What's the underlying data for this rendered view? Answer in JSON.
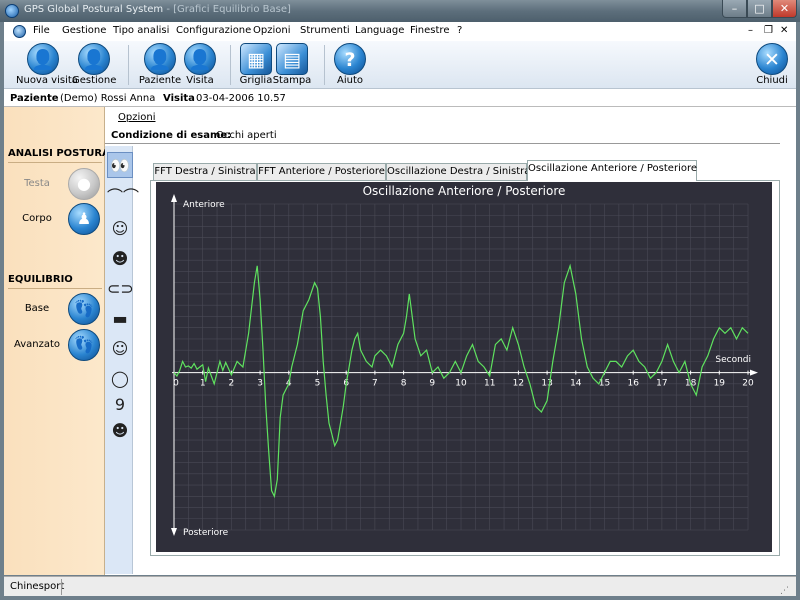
{
  "window": {
    "title": "GPS Global Postural System",
    "subtitle": " - [Grafici Equilibrio Base]"
  },
  "menubar": {
    "items": [
      "File",
      "Gestione",
      "Tipo analisi",
      "Configurazione",
      "Opzioni",
      "Strumenti",
      "Language",
      "Finestre",
      "?"
    ]
  },
  "toolbar": {
    "buttons": [
      "Nuova visita",
      "Gestione",
      "Paziente",
      "Visita",
      "Griglia",
      "Stampa",
      "Aiuto"
    ],
    "close_label": "Chiudi"
  },
  "patient": {
    "label_paziente": "Paziente",
    "name": "(Demo) Rossi Anna",
    "label_visita": "Visita",
    "visit_date": "03-04-2006 10.57"
  },
  "left_panel": {
    "analisi_header": "ANALISI POSTURALE",
    "testa": "Testa",
    "corpo": "Corpo",
    "equilibrio_header": "EQUILIBRIO",
    "base": "Base",
    "avanzato": "Avanzato"
  },
  "options_menu": "Opzioni",
  "condition": {
    "label": "Condizione di esame:",
    "value": "Occhi aperti"
  },
  "tabs": [
    "FFT Destra / Sinistra",
    "FFT Anteriore / Posteriore",
    "Oscillazione Destra / Sinistra",
    "Oscillazione Anteriore / Posteriore"
  ],
  "active_tab": 3,
  "icon_strip": [
    "eyes-open-icon",
    "eyes-closed-icon",
    "head-side-icon",
    "head-front-icon",
    "lips-icon",
    "lips-closed-icon",
    "head-profile-icon",
    "mouth-open-icon",
    "number-nine-icon",
    "head-tilt-icon"
  ],
  "status": {
    "text": "Chinesport"
  },
  "chart_data": {
    "type": "line",
    "title": "Oscillazione Anteriore / Posteriore",
    "xlabel": "Secondi",
    "y_top_label": "Anteriore",
    "y_bottom_label": "Posteriore",
    "xlim": [
      0,
      20
    ],
    "ylim": [
      -14,
      15
    ],
    "x_ticks": [
      "0",
      "1",
      "2",
      "3",
      "4",
      "5",
      "6",
      "7",
      "8",
      "9",
      "10",
      "11",
      "12",
      "13",
      "14",
      "15",
      "16",
      "17",
      "18",
      "19",
      "20"
    ],
    "grid": true,
    "colors": {
      "background": "#2f2f3a",
      "grid": "#4a4a56",
      "line": "#5fe25f",
      "axis": "#ffffff"
    },
    "series": [
      {
        "x": [
          0,
          0.1,
          0.2,
          0.3,
          0.4,
          0.5,
          0.6,
          0.7,
          0.8,
          0.9,
          1.0,
          1.1,
          1.2,
          1.4,
          1.6,
          1.7,
          1.8,
          2.0,
          2.2,
          2.4,
          2.6,
          2.8,
          2.9,
          3.0,
          3.1,
          3.2,
          3.3,
          3.4,
          3.5,
          3.6,
          3.7,
          3.8,
          3.9,
          4.0,
          4.1,
          4.3,
          4.5,
          4.7,
          4.9,
          5.0,
          5.1,
          5.2,
          5.3,
          5.4,
          5.5,
          5.6,
          5.7,
          5.8,
          5.9,
          6.0,
          6.1,
          6.2,
          6.3,
          6.4,
          6.5,
          6.7,
          6.9,
          7.0,
          7.2,
          7.4,
          7.6,
          7.8,
          8.0,
          8.1,
          8.2,
          8.4,
          8.6,
          8.8,
          9.0,
          9.2,
          9.4,
          9.6,
          9.8,
          10.0,
          10.2,
          10.4,
          10.6,
          10.8,
          11.0,
          11.2,
          11.4,
          11.6,
          11.8,
          12.0,
          12.2,
          12.4,
          12.6,
          12.8,
          13.0,
          13.2,
          13.4,
          13.6,
          13.8,
          14.0,
          14.2,
          14.4,
          14.6,
          14.8,
          15.0,
          15.2,
          15.4,
          15.6,
          15.8,
          16.0,
          16.2,
          16.4,
          16.6,
          16.8,
          17.0,
          17.2,
          17.4,
          17.6,
          17.8,
          18.0,
          18.2,
          18.4,
          18.6,
          18.8,
          19.0,
          19.2,
          19.4,
          19.6,
          19.8,
          20.0
        ],
        "y": [
          0,
          -0.3,
          0.2,
          1.0,
          0.5,
          0.6,
          0.4,
          0.8,
          0.3,
          0.5,
          0.7,
          -0.8,
          0.4,
          -1.0,
          1.0,
          0.2,
          0.9,
          -0.2,
          1.0,
          0.5,
          3.5,
          8.0,
          9.5,
          6.5,
          2.0,
          -3.0,
          -7.0,
          -10.5,
          -11.0,
          -9.5,
          -4.0,
          -2.0,
          -1.5,
          -1.0,
          0.5,
          2.5,
          5.5,
          6.5,
          8.0,
          7.5,
          5.0,
          1.0,
          -2.0,
          -4.5,
          -5.5,
          -6.5,
          -6.0,
          -4.5,
          -3.0,
          -1.0,
          0.5,
          2.0,
          3.0,
          3.5,
          2.0,
          1.0,
          0.5,
          1.5,
          2.0,
          1.5,
          0.5,
          2.5,
          3.5,
          5.0,
          7.0,
          3.0,
          1.5,
          2.0,
          0.0,
          0.5,
          -0.5,
          0.0,
          1.0,
          0.0,
          1.5,
          2.5,
          1.0,
          0.5,
          -0.3,
          2.5,
          3.0,
          2.0,
          4.0,
          2.5,
          0.5,
          -1.0,
          -3.0,
          -3.5,
          -2.5,
          1.0,
          4.0,
          8.0,
          9.5,
          7.0,
          3.0,
          0.5,
          -0.5,
          -1.0,
          0.0,
          1.0,
          1.0,
          0.5,
          1.5,
          2.0,
          1.0,
          0.5,
          -0.5,
          0.0,
          1.0,
          2.5,
          1.0,
          0.0,
          1.0,
          -1.0,
          -2.0,
          0.5,
          1.5,
          3.0,
          4.0,
          3.5,
          4.0,
          3.0,
          4.0,
          3.5
        ]
      }
    ]
  }
}
